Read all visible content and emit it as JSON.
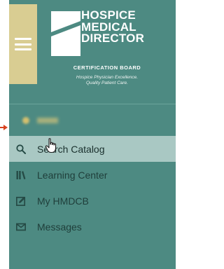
{
  "logo": {
    "line1": "HOSPICE",
    "line2": "MEDICAL",
    "line3": "DIRECTOR",
    "subtitle": "CERTIFICATION BOARD",
    "tagline_1": "Hospice Physician Excellence.",
    "tagline_2": "Quality Patient Care."
  },
  "nav": {
    "items": [
      {
        "label": "Search Catalog",
        "icon": "search-icon"
      },
      {
        "label": "Learning Center",
        "icon": "library-icon"
      },
      {
        "label": "My HMDCB",
        "icon": "edit-icon"
      },
      {
        "label": "Messages",
        "icon": "envelope-icon"
      }
    ],
    "active_index": 0
  },
  "colors": {
    "sidebar": "#4d8a82",
    "menu_button": "#d9cd92",
    "active_item": "#a9c8c3",
    "annotation_arrow": "#d8421f"
  }
}
